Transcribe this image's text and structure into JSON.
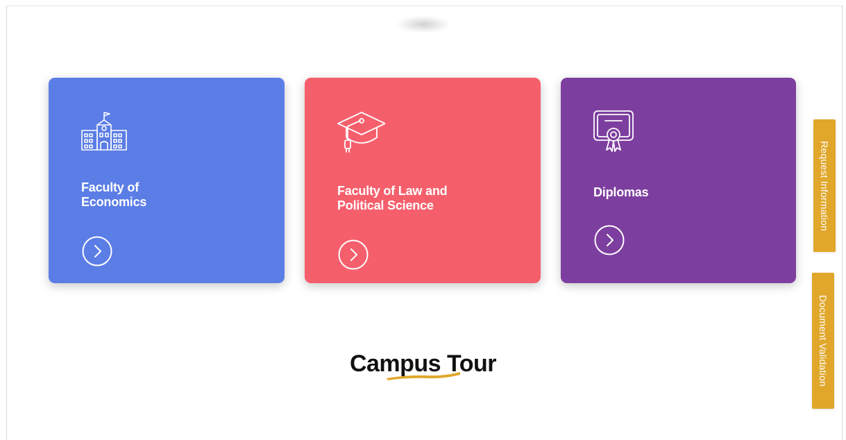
{
  "cards": [
    {
      "title": "Faculty of Economics",
      "title_lines": [
        "Faculty of",
        "Economics"
      ],
      "icon": "university-building-icon",
      "color": "#5b7de6"
    },
    {
      "title": "Faculty of Law and Political Science",
      "title_lines": [
        "Faculty of Law and",
        "Political Science"
      ],
      "icon": "graduation-cap-icon",
      "color": "#f55f6c"
    },
    {
      "title": "Diplomas",
      "title_lines": [
        "Diplomas"
      ],
      "icon": "diploma-certificate-icon",
      "color": "#7d3f9f"
    }
  ],
  "card_arrow_icon": "chevron-right-circle-icon",
  "side_tabs": {
    "request_label": "Request Information",
    "document_label": "Document Validation",
    "color": "#e0a72b"
  },
  "section": {
    "title": "Campus Tour",
    "underline_color": "#e0a72b"
  }
}
